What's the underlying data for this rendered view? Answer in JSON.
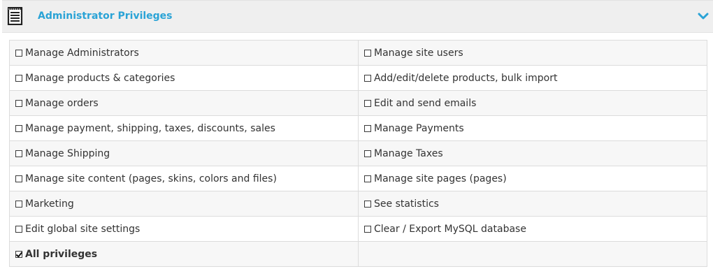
{
  "panel": {
    "title": "Administrator Privileges",
    "icon": "document-list-icon",
    "toggle_icon": "chevron-down-icon",
    "accent_color": "#2aa3d6"
  },
  "privileges": {
    "r0": {
      "left": {
        "label": "Manage Administrators",
        "checked": false
      },
      "right": {
        "label": "Manage site users",
        "checked": false
      }
    },
    "r1": {
      "left": {
        "label": "Manage products & categories",
        "checked": false
      },
      "right": {
        "label": "Add/edit/delete products, bulk import",
        "checked": false
      }
    },
    "r2": {
      "left": {
        "label": "Manage orders",
        "checked": false
      },
      "right": {
        "label": "Edit and send emails",
        "checked": false
      }
    },
    "r3": {
      "left": {
        "label": "Manage payment, shipping, taxes, discounts, sales",
        "checked": false
      },
      "right": {
        "label": "Manage Payments",
        "checked": false
      }
    },
    "r4": {
      "left": {
        "label": "Manage Shipping",
        "checked": false
      },
      "right": {
        "label": "Manage Taxes",
        "checked": false
      }
    },
    "r5": {
      "left": {
        "label": "Manage site content (pages, skins, colors and files)",
        "checked": false
      },
      "right": {
        "label": "Manage site pages (pages)",
        "checked": false
      }
    },
    "r6": {
      "left": {
        "label": "Marketing",
        "checked": false
      },
      "right": {
        "label": "See statistics",
        "checked": false
      }
    },
    "r7": {
      "left": {
        "label": "Edit global site settings",
        "checked": false
      },
      "right": {
        "label": "Clear / Export MySQL database",
        "checked": false
      }
    },
    "r8": {
      "left": {
        "label": "All privileges",
        "checked": true
      }
    }
  }
}
